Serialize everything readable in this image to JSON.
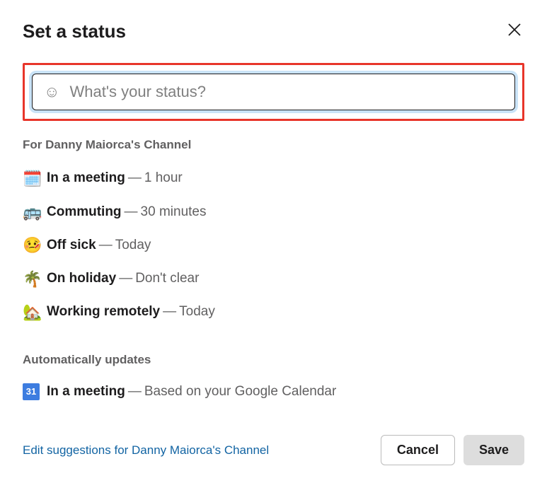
{
  "header": {
    "title": "Set a status"
  },
  "input": {
    "placeholder": "What's your status?"
  },
  "section1": {
    "label": "For Danny Maiorca's Channel",
    "items": [
      {
        "emoji": "🗓️",
        "label": "In a meeting",
        "duration": "1 hour"
      },
      {
        "emoji": "🚌",
        "label": "Commuting",
        "duration": "30 minutes"
      },
      {
        "emoji": "🤒",
        "label": "Off sick",
        "duration": "Today"
      },
      {
        "emoji": "🌴",
        "label": "On holiday",
        "duration": "Don't clear"
      },
      {
        "emoji": "🏡",
        "label": "Working remotely",
        "duration": "Today"
      }
    ]
  },
  "section2": {
    "label": "Automatically updates",
    "items": [
      {
        "icon_text": "31",
        "label": "In a meeting",
        "duration": "Based on your Google Calendar"
      }
    ]
  },
  "footer": {
    "edit_link": "Edit suggestions for Danny Maiorca's Channel",
    "cancel": "Cancel",
    "save": "Save"
  },
  "sep": " — "
}
